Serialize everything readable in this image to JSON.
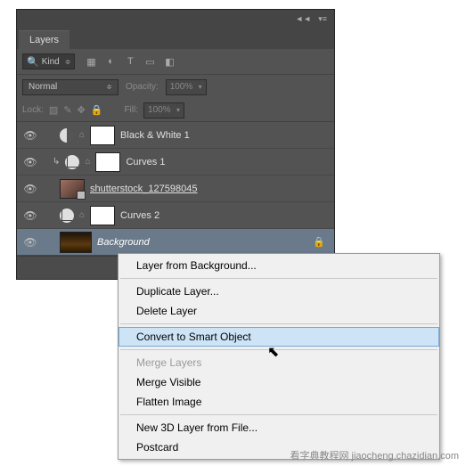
{
  "panel": {
    "title": "Layers",
    "kind_label": "Kind",
    "blend_mode": "Normal",
    "opacity_label": "Opacity:",
    "opacity_value": "100%",
    "lock_label": "Lock:",
    "fill_label": "Fill:",
    "fill_value": "100%",
    "layers": [
      {
        "name": "Black & White 1",
        "type": "adjust-bw"
      },
      {
        "name": "Curves 1",
        "type": "adjust-curves"
      },
      {
        "name": "shutterstock_127598045",
        "type": "smartobj"
      },
      {
        "name": "Curves 2",
        "type": "adjust-curves"
      },
      {
        "name": "Background",
        "type": "background"
      }
    ]
  },
  "context_menu": {
    "items": [
      {
        "label": "Layer from Background...",
        "enabled": true
      },
      {
        "sep": true
      },
      {
        "label": "Duplicate Layer...",
        "enabled": true
      },
      {
        "label": "Delete Layer",
        "enabled": true
      },
      {
        "sep": true
      },
      {
        "label": "Convert to Smart Object",
        "enabled": true,
        "hover": true
      },
      {
        "sep": true
      },
      {
        "label": "Merge Layers",
        "enabled": false
      },
      {
        "label": "Merge Visible",
        "enabled": true
      },
      {
        "label": "Flatten Image",
        "enabled": true
      },
      {
        "sep": true
      },
      {
        "label": "New 3D Layer from File...",
        "enabled": true
      },
      {
        "label": "Postcard",
        "enabled": true
      }
    ]
  },
  "watermark": "看字典教程网 jiaocheng.chazidian.com"
}
